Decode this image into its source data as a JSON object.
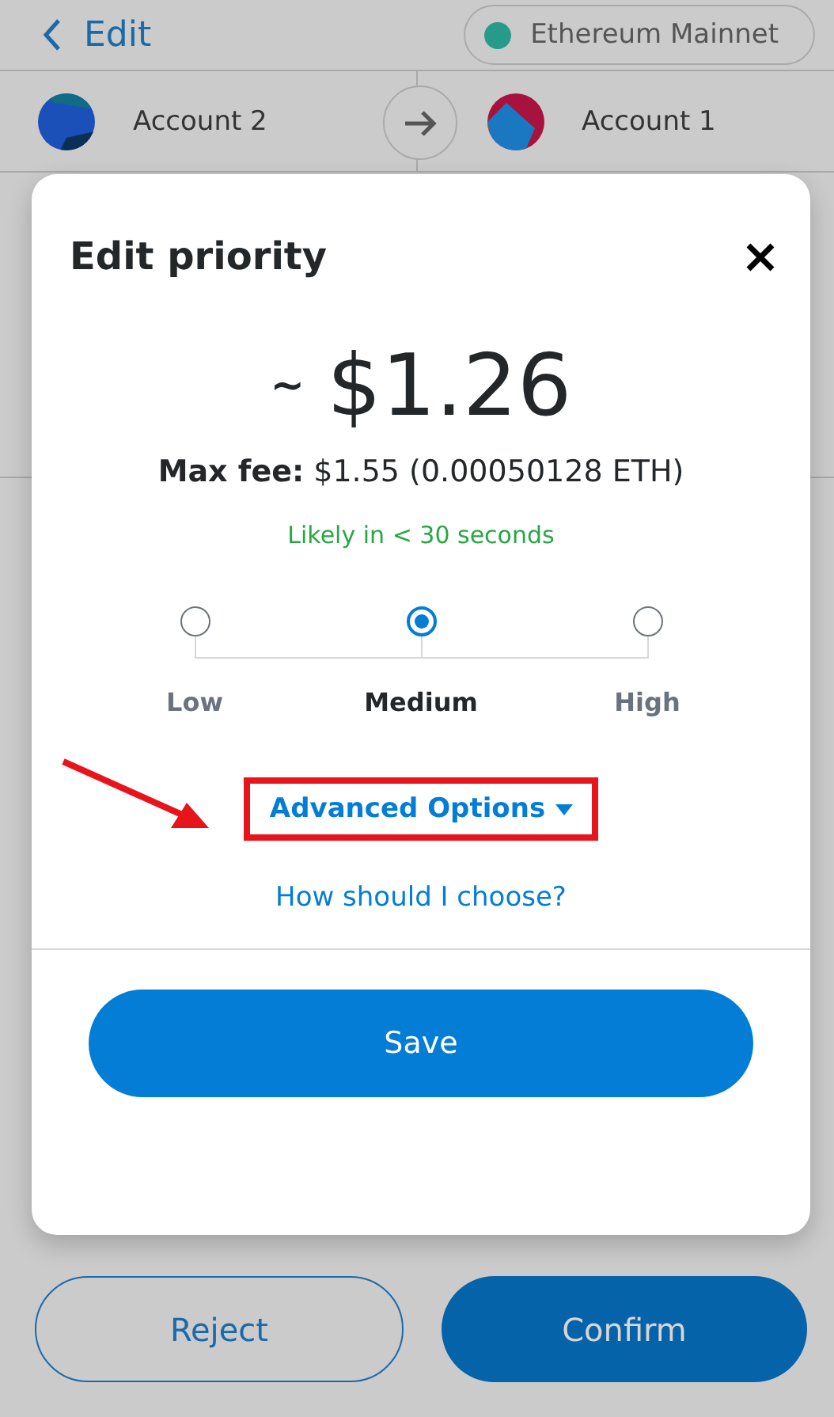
{
  "header": {
    "back_label": "Edit",
    "network": "Ethereum Mainnet"
  },
  "accounts": {
    "from": "Account 2",
    "to": "Account 1"
  },
  "modal": {
    "title": "Edit priority",
    "approx": "~",
    "amount": "$1.26",
    "max_fee": "**Max fee:** $1.55 (0.00050128 ETH)",
    "estimate": "Likely in < 30 seconds",
    "levels": [
      {
        "label": "Low",
        "selected": false
      },
      {
        "label": "Medium",
        "selected": true
      },
      {
        "label": "High",
        "selected": false
      }
    ],
    "advanced_options": "Advanced Options",
    "help_link": "How should I choose?",
    "save": "Save"
  },
  "footer": {
    "reject": "Reject",
    "confirm": "Confirm"
  }
}
